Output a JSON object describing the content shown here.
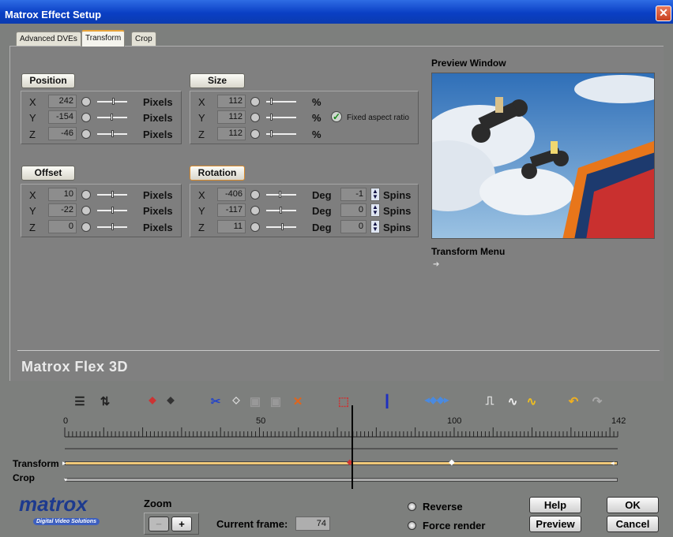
{
  "window": {
    "title": "Matrox Effect Setup",
    "close": "✕"
  },
  "tabs": [
    {
      "label": "Advanced DVEs",
      "active": false
    },
    {
      "label": "Transform",
      "active": true
    },
    {
      "label": "Crop",
      "active": false
    }
  ],
  "position": {
    "label": "Position",
    "rows": [
      {
        "axis": "X",
        "value": "242",
        "unit": "Pixels"
      },
      {
        "axis": "Y",
        "value": "-154",
        "unit": "Pixels"
      },
      {
        "axis": "Z",
        "value": "-46",
        "unit": "Pixels"
      }
    ]
  },
  "size": {
    "label": "Size",
    "rows": [
      {
        "axis": "X",
        "value": "112",
        "unit": "%"
      },
      {
        "axis": "Y",
        "value": "112",
        "unit": "%"
      },
      {
        "axis": "Z",
        "value": "112",
        "unit": "%"
      }
    ],
    "fixed_aspect_label": "Fixed aspect ratio",
    "fixed_aspect_checked": true
  },
  "offset": {
    "label": "Offset",
    "rows": [
      {
        "axis": "X",
        "value": "10",
        "unit": "Pixels"
      },
      {
        "axis": "Y",
        "value": "-22",
        "unit": "Pixels"
      },
      {
        "axis": "Z",
        "value": "0",
        "unit": "Pixels"
      }
    ]
  },
  "rotation": {
    "label": "Rotation",
    "rows": [
      {
        "axis": "X",
        "value": "-406",
        "unit": "Deg",
        "spins": "-1",
        "spins_label": "Spins"
      },
      {
        "axis": "Y",
        "value": "-117",
        "unit": "Deg",
        "spins": "0",
        "spins_label": "Spins"
      },
      {
        "axis": "Z",
        "value": "11",
        "unit": "Deg",
        "spins": "0",
        "spins_label": "Spins"
      }
    ]
  },
  "preview": {
    "label": "Preview Window"
  },
  "transform_menu": {
    "label": "Transform Menu"
  },
  "product_name": "Matrox Flex 3D",
  "timeline": {
    "ruler_labels": [
      "0",
      "50",
      "100",
      "142"
    ],
    "current_frame_fraction": 0.511,
    "tracks": [
      {
        "label": "Transform",
        "keyframes": [
          "0",
          "74",
          "100",
          "142"
        ]
      },
      {
        "label": "Crop"
      }
    ]
  },
  "bottom": {
    "logo_text": "matrox",
    "logo_sub": "Digital Video Solutions",
    "zoom_label": "Zoom",
    "zoom_minus": "−",
    "zoom_plus": "+",
    "current_frame_label": "Current frame:",
    "current_frame_value": "74",
    "reverse_label": "Reverse",
    "force_render_label": "Force render",
    "help": "Help",
    "ok": "OK",
    "preview": "Preview",
    "cancel": "Cancel"
  },
  "colors": {
    "accent": "#e8a33a",
    "title_bar": "#0a3fc4",
    "keyframe_track": "#f0c878"
  }
}
